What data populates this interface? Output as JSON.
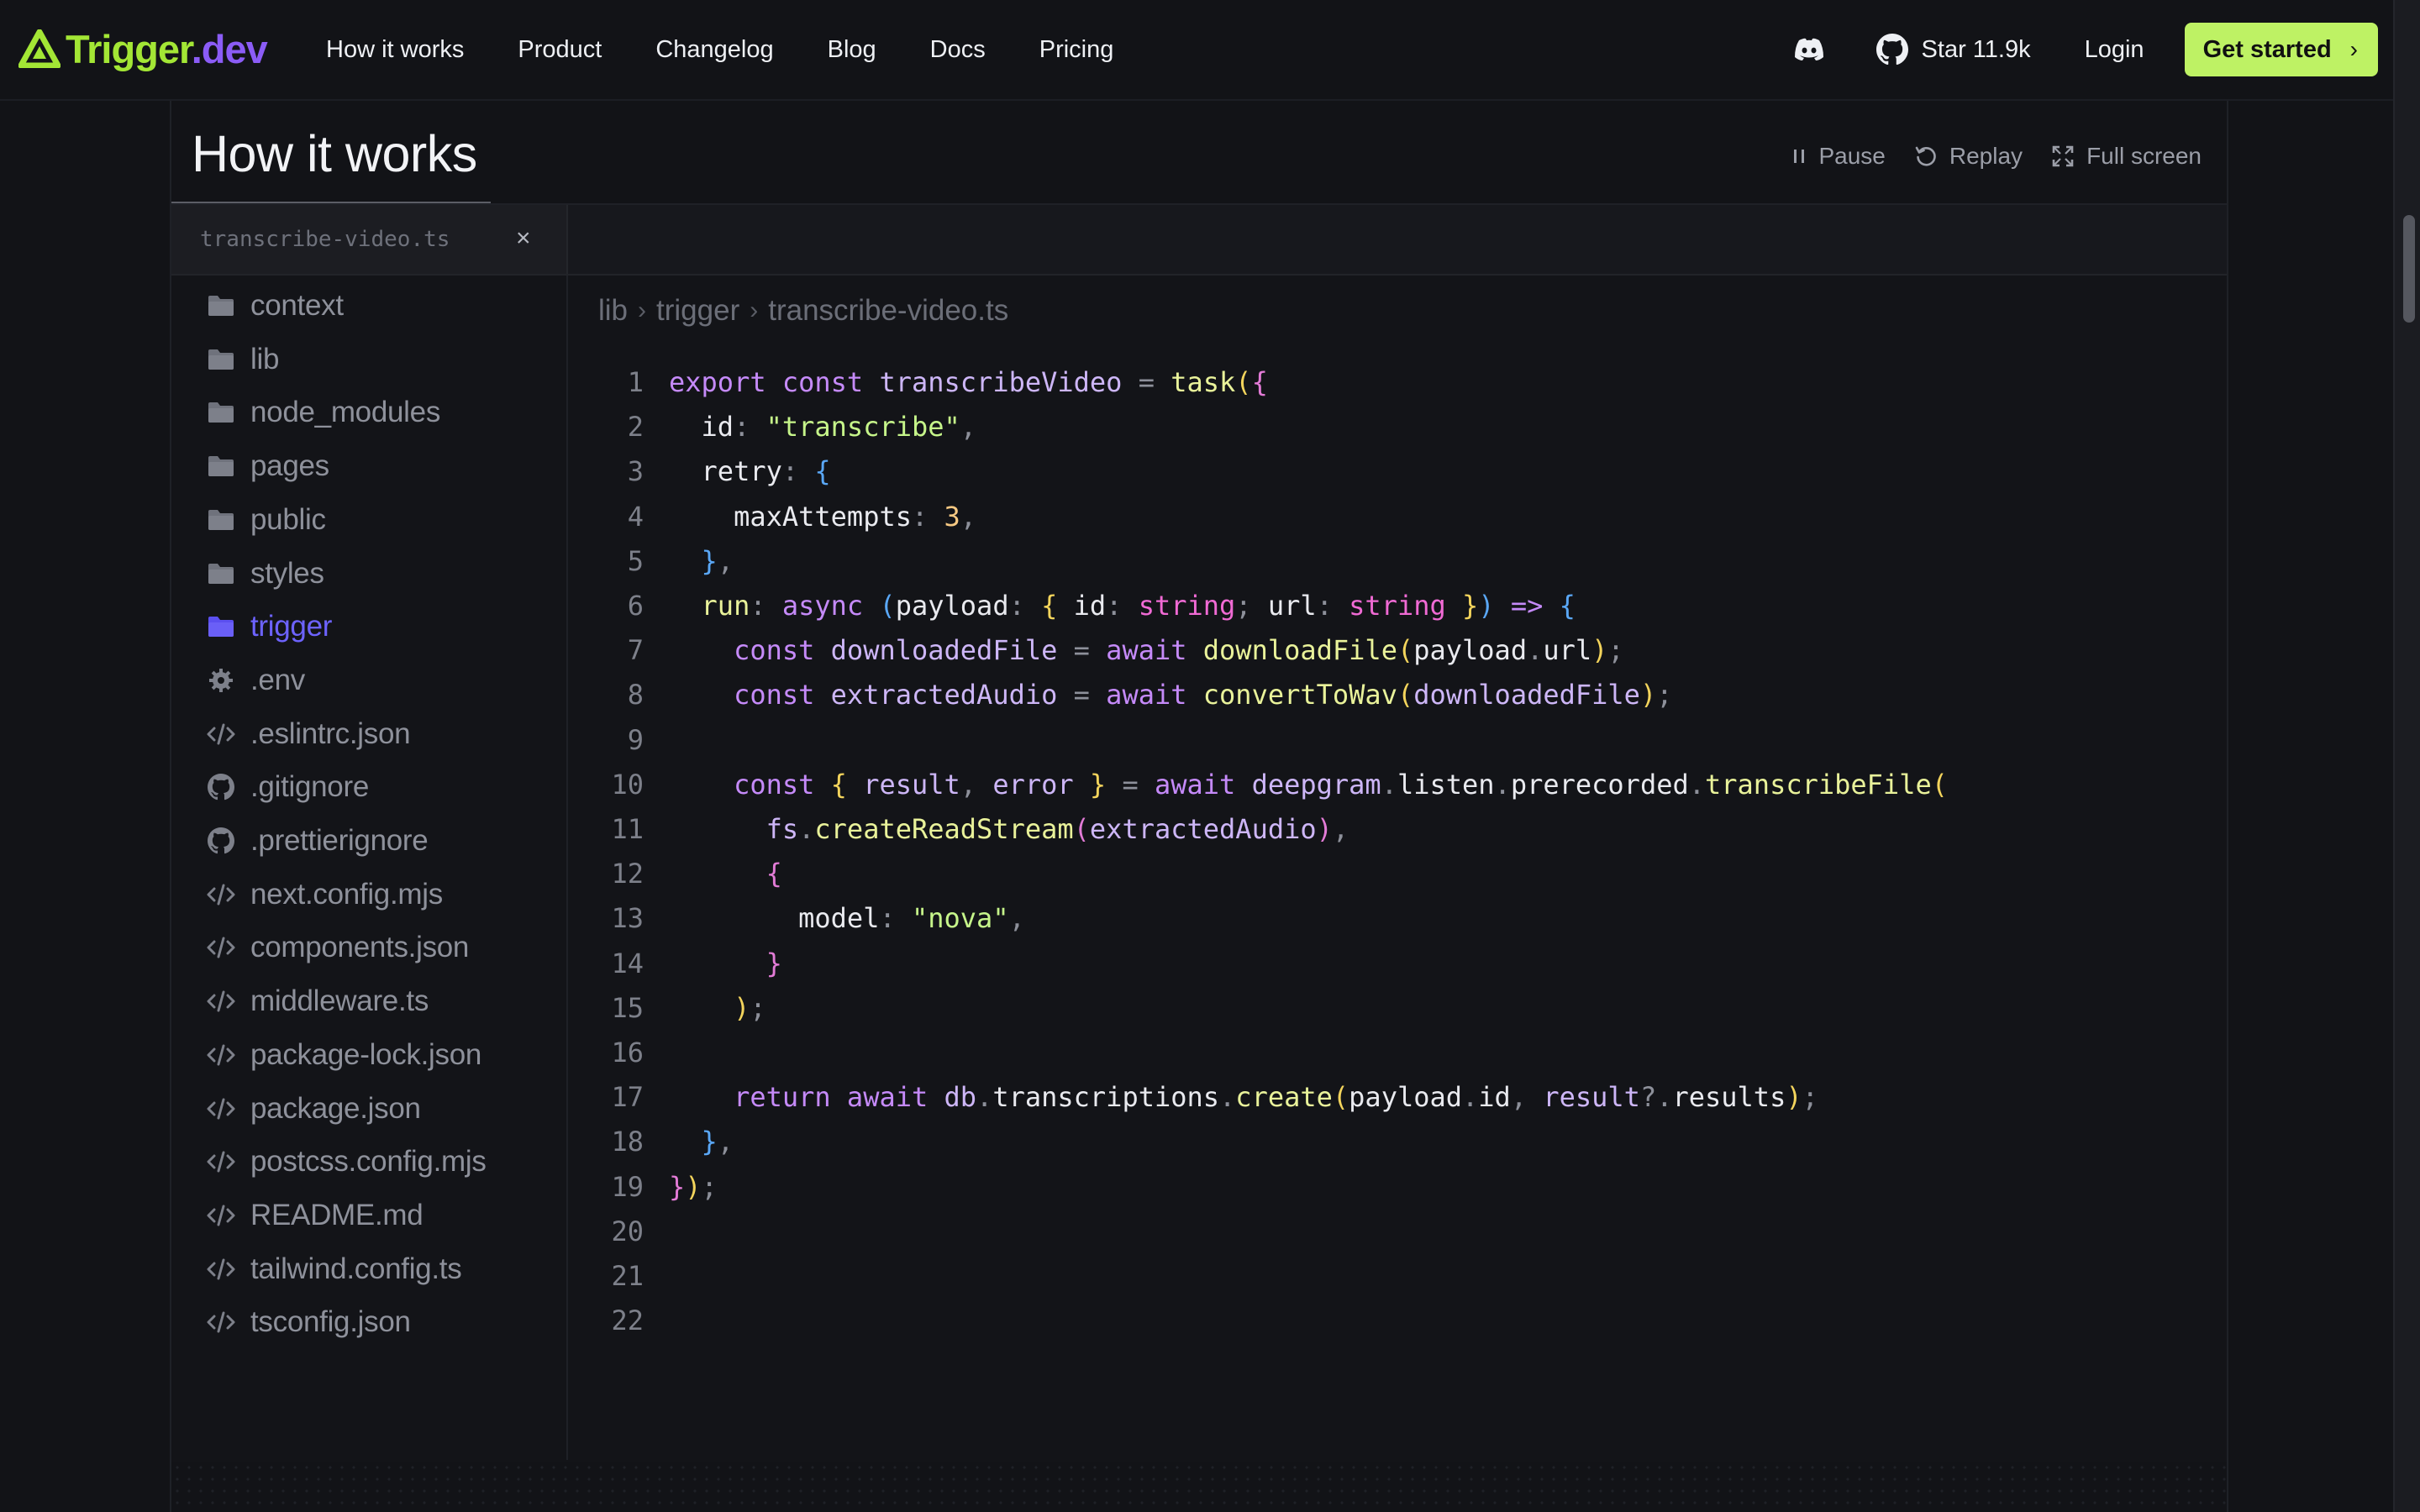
{
  "nav": {
    "logo_part1": "Trigger",
    "logo_part2": ".dev",
    "links": [
      "How it works",
      "Product",
      "Changelog",
      "Blog",
      "Docs",
      "Pricing"
    ],
    "github_label": "Star 11.9k",
    "login": "Login",
    "cta": "Get started",
    "cta_chevron": "›"
  },
  "section": {
    "title": "How it works",
    "controls": {
      "pause": "Pause",
      "replay": "Replay",
      "fullscreen": "Full screen"
    }
  },
  "editor": {
    "tab": {
      "name": "transcribe-video.ts",
      "close": "×"
    },
    "breadcrumb": [
      "lib",
      "trigger",
      "transcribe-video.ts"
    ],
    "breadcrumb_sep": "›",
    "files": [
      {
        "name": "context",
        "icon": "folder-icon"
      },
      {
        "name": "lib",
        "icon": "folder-icon"
      },
      {
        "name": "node_modules",
        "icon": "folder-icon"
      },
      {
        "name": "pages",
        "icon": "folder-icon"
      },
      {
        "name": "public",
        "icon": "folder-icon"
      },
      {
        "name": "styles",
        "icon": "folder-icon"
      },
      {
        "name": "trigger",
        "icon": "folder-icon",
        "active": true
      },
      {
        "name": ".env",
        "icon": "gear-icon"
      },
      {
        "name": ".eslintrc.json",
        "icon": "code-icon"
      },
      {
        "name": ".gitignore",
        "icon": "github-icon"
      },
      {
        "name": ".prettierignore",
        "icon": "github-icon"
      },
      {
        "name": "next.config.mjs",
        "icon": "code-icon"
      },
      {
        "name": "components.json",
        "icon": "code-icon"
      },
      {
        "name": "middleware.ts",
        "icon": "code-icon"
      },
      {
        "name": "package-lock.json",
        "icon": "code-icon"
      },
      {
        "name": "package.json",
        "icon": "code-icon"
      },
      {
        "name": "postcss.config.mjs",
        "icon": "code-icon"
      },
      {
        "name": "README.md",
        "icon": "code-icon"
      },
      {
        "name": "tailwind.config.ts",
        "icon": "code-icon"
      },
      {
        "name": "tsconfig.json",
        "icon": "code-icon"
      }
    ],
    "code_lines": [
      [
        [
          "kw",
          "export "
        ],
        [
          "kw",
          "const "
        ],
        [
          "var",
          "transcribeVideo "
        ],
        [
          "pun",
          "= "
        ],
        [
          "fn",
          "task"
        ],
        [
          "br1",
          "("
        ],
        [
          "br2",
          "{"
        ]
      ],
      [
        [
          "pl",
          "  "
        ],
        [
          "prop",
          "id"
        ],
        [
          "pun",
          ": "
        ],
        [
          "str",
          "\"transcribe\""
        ],
        [
          "pun",
          ","
        ]
      ],
      [
        [
          "pl",
          "  "
        ],
        [
          "prop",
          "retry"
        ],
        [
          "pun",
          ": "
        ],
        [
          "br3",
          "{"
        ]
      ],
      [
        [
          "pl",
          "    "
        ],
        [
          "prop",
          "maxAttempts"
        ],
        [
          "pun",
          ": "
        ],
        [
          "num",
          "3"
        ],
        [
          "pun",
          ","
        ]
      ],
      [
        [
          "pl",
          "  "
        ],
        [
          "br3",
          "}"
        ],
        [
          "pun",
          ","
        ]
      ],
      [
        [
          "pl",
          "  "
        ],
        [
          "fn",
          "run"
        ],
        [
          "pun",
          ": "
        ],
        [
          "kw",
          "async "
        ],
        [
          "br3",
          "("
        ],
        [
          "prop",
          "payload"
        ],
        [
          "pun",
          ": "
        ],
        [
          "br1",
          "{ "
        ],
        [
          "prop",
          "id"
        ],
        [
          "pun",
          ": "
        ],
        [
          "ty",
          "string"
        ],
        [
          "pun",
          "; "
        ],
        [
          "prop",
          "url"
        ],
        [
          "pun",
          ": "
        ],
        [
          "ty",
          "string "
        ],
        [
          "br1",
          "}"
        ],
        [
          "br3",
          ") "
        ],
        [
          "kw",
          "=> "
        ],
        [
          "br3",
          "{"
        ]
      ],
      [
        [
          "pl",
          "    "
        ],
        [
          "kw",
          "const "
        ],
        [
          "var",
          "downloadedFile "
        ],
        [
          "pun",
          "= "
        ],
        [
          "kw",
          "await "
        ],
        [
          "fn",
          "downloadFile"
        ],
        [
          "br1",
          "("
        ],
        [
          "prop",
          "payload"
        ],
        [
          "pun",
          "."
        ],
        [
          "prop",
          "url"
        ],
        [
          "br1",
          ")"
        ],
        [
          "pun",
          ";"
        ]
      ],
      [
        [
          "pl",
          "    "
        ],
        [
          "kw",
          "const "
        ],
        [
          "var",
          "extractedAudio "
        ],
        [
          "pun",
          "= "
        ],
        [
          "kw",
          "await "
        ],
        [
          "fn",
          "convertToWav"
        ],
        [
          "br1",
          "("
        ],
        [
          "var",
          "downloadedFile"
        ],
        [
          "br1",
          ")"
        ],
        [
          "pun",
          ";"
        ]
      ],
      [],
      [
        [
          "pl",
          "    "
        ],
        [
          "kw",
          "const "
        ],
        [
          "br1",
          "{ "
        ],
        [
          "var",
          "result"
        ],
        [
          "pun",
          ", "
        ],
        [
          "var",
          "error "
        ],
        [
          "br1",
          "} "
        ],
        [
          "pun",
          "= "
        ],
        [
          "kw",
          "await "
        ],
        [
          "var",
          "deepgram"
        ],
        [
          "pun",
          "."
        ],
        [
          "prop",
          "listen"
        ],
        [
          "pun",
          "."
        ],
        [
          "prop",
          "prerecorded"
        ],
        [
          "pun",
          "."
        ],
        [
          "fn",
          "transcribeFile"
        ],
        [
          "br1",
          "("
        ]
      ],
      [
        [
          "pl",
          "      "
        ],
        [
          "var",
          "fs"
        ],
        [
          "pun",
          "."
        ],
        [
          "fn",
          "createReadStream"
        ],
        [
          "br2",
          "("
        ],
        [
          "var",
          "extractedAudio"
        ],
        [
          "br2",
          ")"
        ],
        [
          "pun",
          ","
        ]
      ],
      [
        [
          "pl",
          "      "
        ],
        [
          "br2",
          "{"
        ]
      ],
      [
        [
          "pl",
          "        "
        ],
        [
          "prop",
          "model"
        ],
        [
          "pun",
          ": "
        ],
        [
          "str",
          "\"nova\""
        ],
        [
          "pun",
          ","
        ]
      ],
      [
        [
          "pl",
          "      "
        ],
        [
          "br2",
          "}"
        ]
      ],
      [
        [
          "pl",
          "    "
        ],
        [
          "br1",
          ")"
        ],
        [
          "pun",
          ";"
        ]
      ],
      [],
      [
        [
          "pl",
          "    "
        ],
        [
          "kw",
          "return "
        ],
        [
          "kw",
          "await "
        ],
        [
          "var",
          "db"
        ],
        [
          "pun",
          "."
        ],
        [
          "prop",
          "transcriptions"
        ],
        [
          "pun",
          "."
        ],
        [
          "fn",
          "create"
        ],
        [
          "br1",
          "("
        ],
        [
          "prop",
          "payload"
        ],
        [
          "pun",
          "."
        ],
        [
          "prop",
          "id"
        ],
        [
          "pun",
          ", "
        ],
        [
          "var",
          "result"
        ],
        [
          "pun",
          "?."
        ],
        [
          "prop",
          "results"
        ],
        [
          "br1",
          ")"
        ],
        [
          "pun",
          ";"
        ]
      ],
      [
        [
          "pl",
          "  "
        ],
        [
          "br3",
          "}"
        ],
        [
          "pun",
          ","
        ]
      ],
      [
        [
          "br2",
          "}"
        ],
        [
          "br1",
          ")"
        ],
        [
          "pun",
          ";"
        ]
      ],
      [],
      [],
      []
    ]
  }
}
